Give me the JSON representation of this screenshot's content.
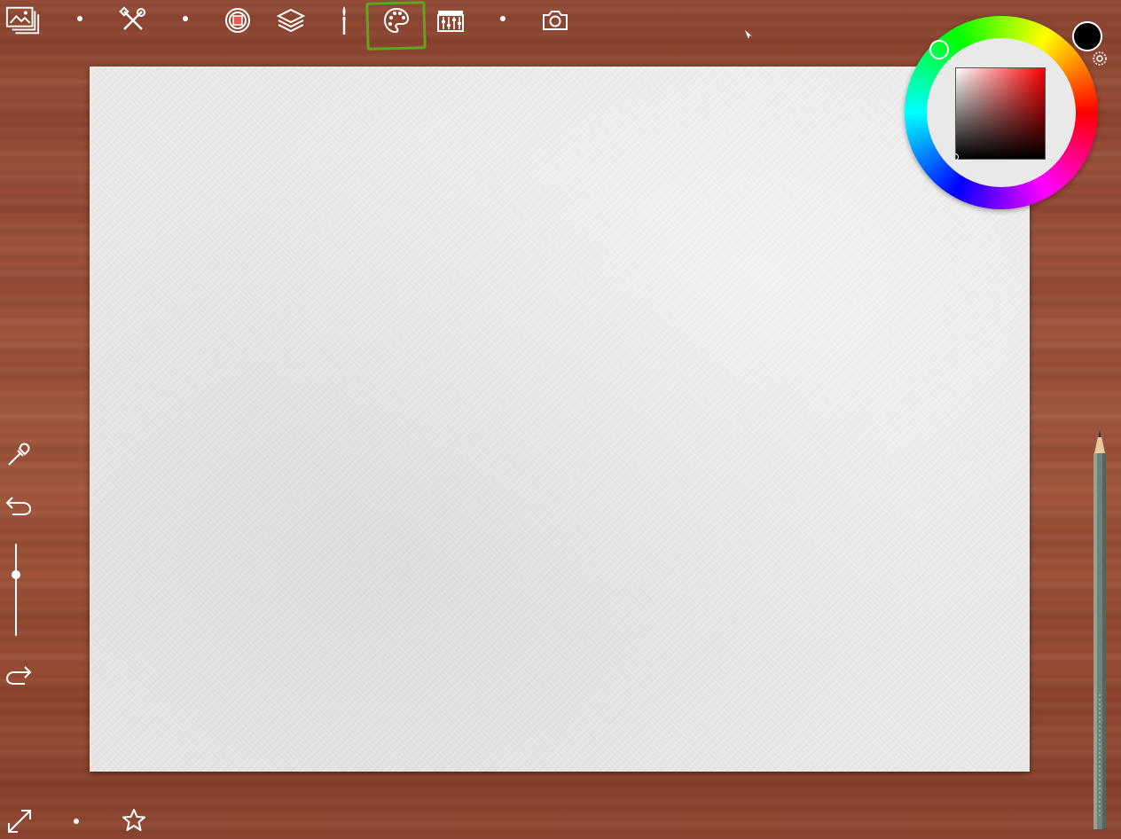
{
  "app": {
    "toolbar": {
      "items": [
        {
          "name": "gallery",
          "icon": "gallery-icon"
        },
        {
          "name": "tools",
          "icon": "tools-icon"
        },
        {
          "name": "selection",
          "icon": "selection-icon"
        },
        {
          "name": "layers",
          "icon": "layers-icon"
        },
        {
          "name": "brush",
          "icon": "brush-icon"
        },
        {
          "name": "color-palette",
          "icon": "palette-icon",
          "active": true
        },
        {
          "name": "adjustments",
          "icon": "adjustments-icon"
        },
        {
          "name": "camera",
          "icon": "camera-icon"
        }
      ]
    },
    "color_picker": {
      "current_color": "#000000",
      "hue": "#ff0000"
    },
    "left_tools": {
      "items": [
        "eyedropper-icon",
        "undo-icon",
        "brush-size-slider",
        "redo-icon"
      ],
      "brush_size_level": 0.7
    },
    "bottom_bar": {
      "items": [
        "fullscreen-icon",
        "favorite-icon"
      ]
    },
    "canvas": {
      "background": "#ececec"
    },
    "colors": {
      "wood": "#9b4d36",
      "active_highlight": "#5ea61e"
    }
  }
}
